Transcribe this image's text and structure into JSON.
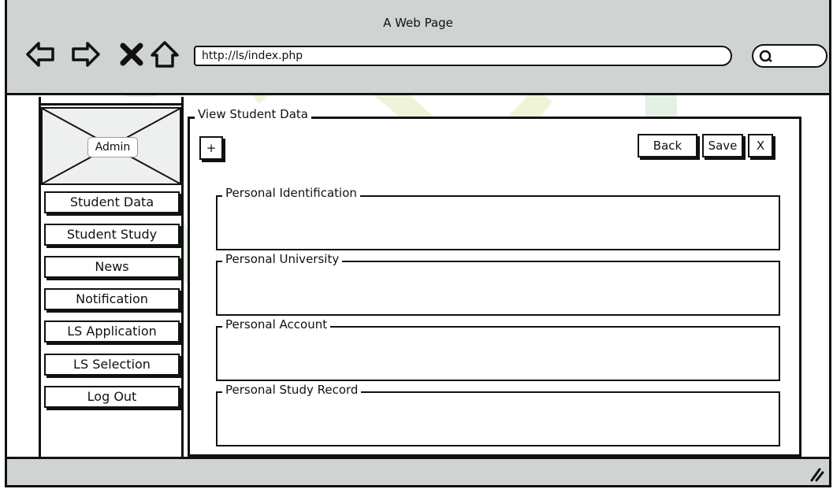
{
  "browser": {
    "page_title": "A Web Page",
    "url": "http://ls/index.php",
    "icons": [
      "back-arrow-icon",
      "forward-arrow-icon",
      "close-icon",
      "home-icon",
      "search-icon"
    ]
  },
  "sidebar": {
    "avatar_label": "Admin",
    "items": [
      {
        "label": "Student Data"
      },
      {
        "label": "Student Study"
      },
      {
        "label": "News"
      },
      {
        "label": "Notification"
      },
      {
        "label": "LS Application"
      },
      {
        "label": "LS Selection"
      },
      {
        "label": "Log Out"
      }
    ]
  },
  "main": {
    "group_title": "View Student Data",
    "add_label": "+",
    "back_label": "Back",
    "save_label": "Save",
    "close_label": "X",
    "sections": [
      {
        "title": "Personal Identification"
      },
      {
        "title": "Personal University"
      },
      {
        "title": "Personal Account"
      },
      {
        "title": "Personal Study Record"
      }
    ]
  },
  "colors": {
    "chrome": "#cfd3d2",
    "watermark": "#b7dcb4"
  }
}
